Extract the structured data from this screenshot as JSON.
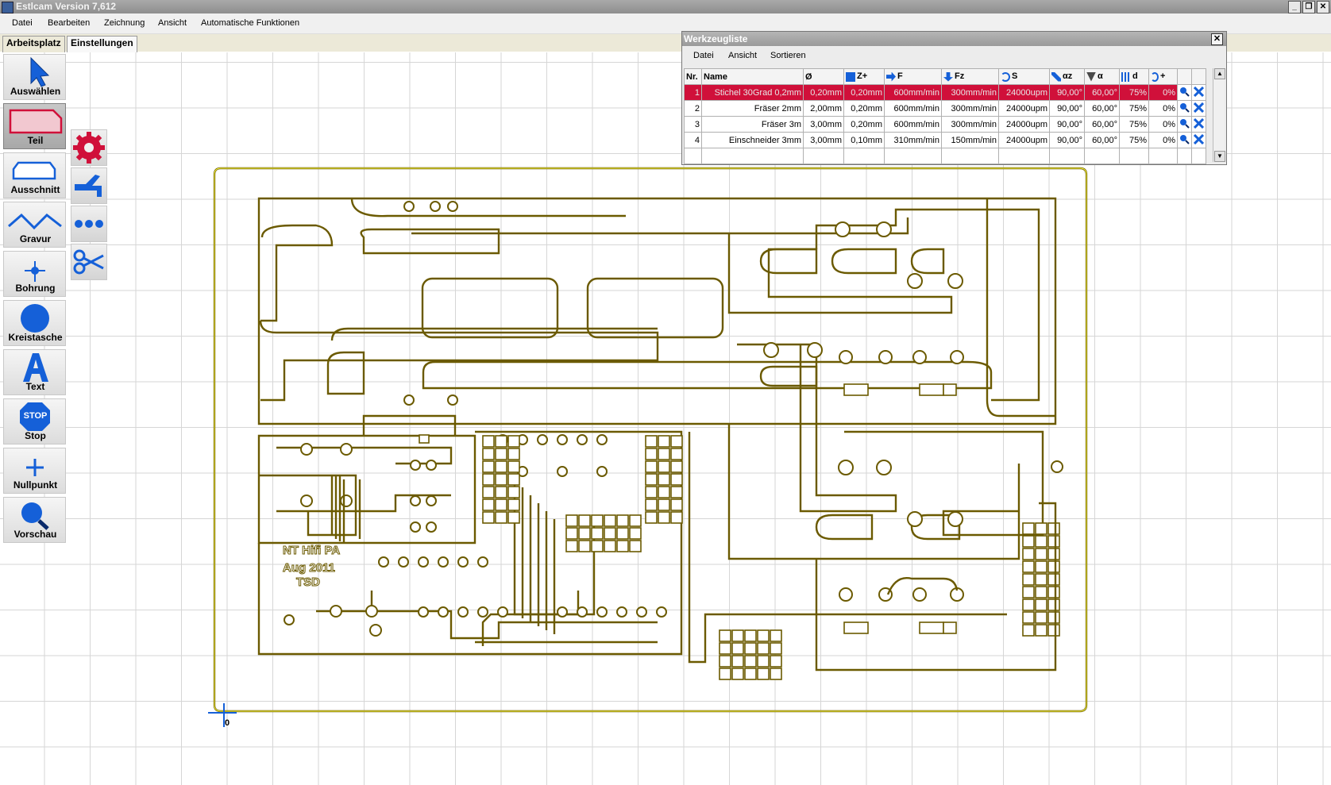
{
  "window": {
    "title": "Estlcam Version 7,612"
  },
  "menu": [
    "Datei",
    "Bearbeiten",
    "Zeichnung",
    "Ansicht",
    "Automatische Funktionen"
  ],
  "tabs": [
    "Arbeitsplatz",
    "Einstellungen"
  ],
  "tools": [
    "Auswählen",
    "Teil",
    "Ausschnitt",
    "Gravur",
    "Bohrung",
    "Kreistasche",
    "Text",
    "Stop",
    "Nullpunkt",
    "Vorschau"
  ],
  "stop_icon_text": "STOP",
  "origin_label": "0",
  "pcb_text": {
    "line1": "NT Hifi PA",
    "line2": "Aug 2011",
    "line3": "TSD"
  },
  "tool_list": {
    "title": "Werkzeugliste",
    "close": "✕",
    "menu": [
      "Datei",
      "Ansicht",
      "Sortieren"
    ],
    "headers": [
      "Nr.",
      "Name",
      "Ø",
      "Z+",
      "F",
      "Fz",
      "S",
      "αz",
      "α",
      "d",
      "+"
    ],
    "rows": [
      [
        "1",
        "Stichel 30Grad 0,2mm",
        "0,20mm",
        "0,20mm",
        "600mm/min",
        "300mm/min",
        "24000upm",
        "90,00°",
        "60,00°",
        "75%",
        "0%"
      ],
      [
        "2",
        "Fräser 2mm",
        "2,00mm",
        "0,20mm",
        "600mm/min",
        "300mm/min",
        "24000upm",
        "90,00°",
        "60,00°",
        "75%",
        "0%"
      ],
      [
        "3",
        "Fräser 3m",
        "3,00mm",
        "0,20mm",
        "600mm/min",
        "300mm/min",
        "24000upm",
        "90,00°",
        "60,00°",
        "75%",
        "0%"
      ],
      [
        "4",
        "Einschneider 3mm",
        "3,00mm",
        "0,10mm",
        "310mm/min",
        "150mm/min",
        "24000upm",
        "90,00°",
        "60,00°",
        "75%",
        "0%"
      ]
    ]
  },
  "colors": {
    "trace": "#6b5a00",
    "trace_fill": "#ffff40",
    "selected_row": "#d0103a",
    "tool_blue": "#1560d8"
  }
}
